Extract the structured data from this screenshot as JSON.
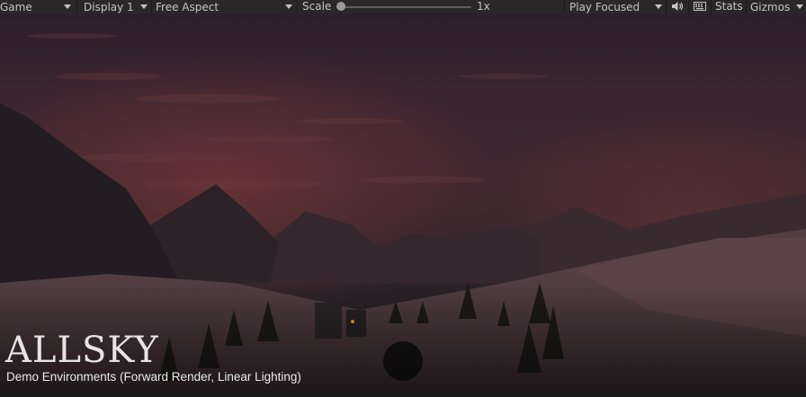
{
  "toolbar": {
    "view_label": "Game",
    "display_label": "Display 1",
    "aspect_label": "Free Aspect",
    "scale_label": "Scale",
    "scale_value_label": "1x",
    "scale_fraction": 0,
    "play_mode_label": "Play Focused",
    "stats_label": "Stats",
    "gizmos_label": "Gizmos",
    "icons": {
      "audio": "speaker-icon",
      "keyboard": "keyboard-icon",
      "dropdown": "chevron-down-icon"
    }
  },
  "viewport": {
    "logo_text": "ALLSKY",
    "subtitle": "Demo Environments (Forward Render, Linear Lighting)"
  },
  "colors": {
    "toolbar_bg": "#282828",
    "toolbar_text": "#c4c4c4",
    "sky_top": "#2e1f2b",
    "sky_horizon": "#3e2730",
    "glow": "#8a3c3a"
  }
}
